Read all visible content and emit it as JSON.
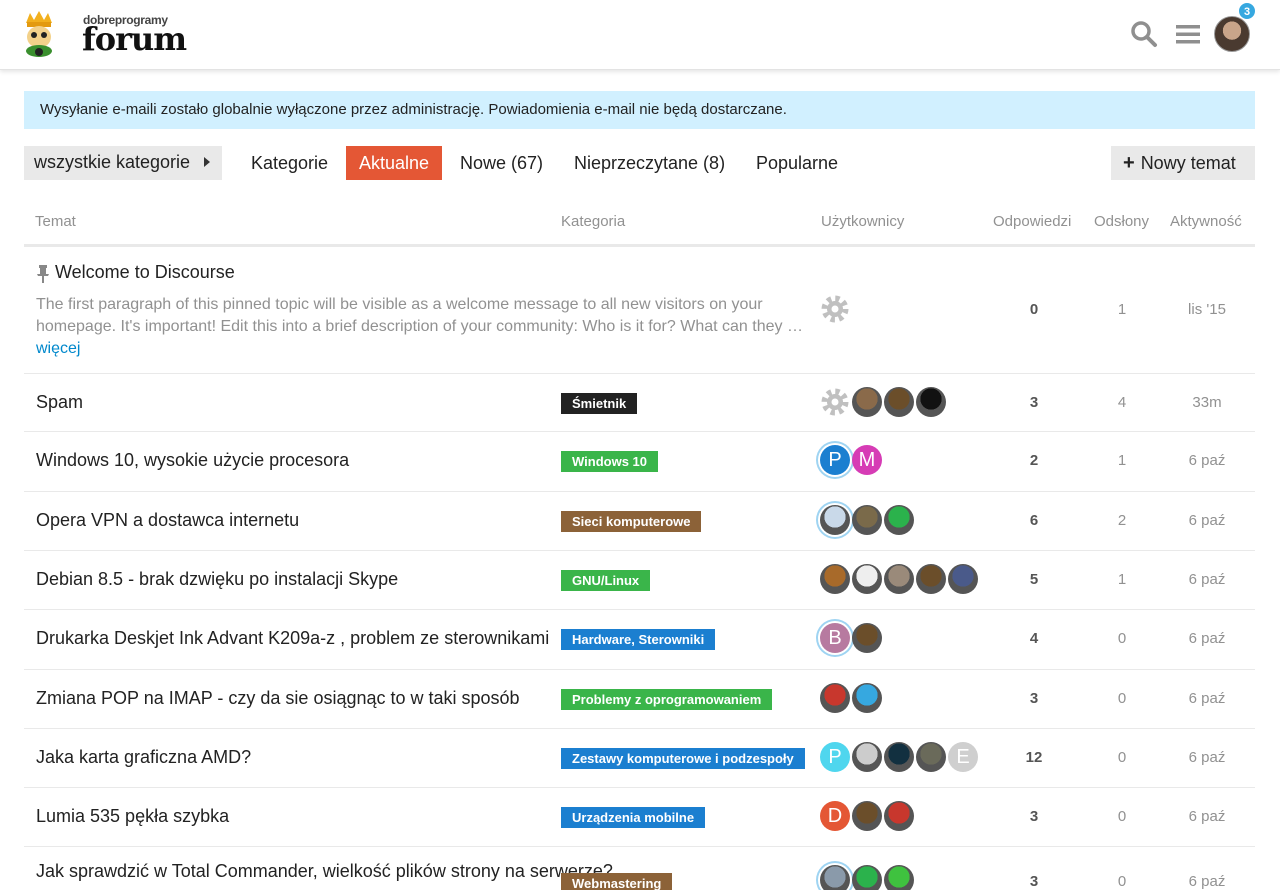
{
  "header": {
    "logo_small": "dobreprogramy",
    "logo_big": "forum",
    "notification_count": "3",
    "colors": {
      "accent": "#e45735",
      "alert_bg": "#d1f0ff",
      "badge": "#36a8e0"
    }
  },
  "alert": {
    "text": "Wysyłanie e-maili zostało globalnie wyłączone przez administrację. Powiadomienia e-mail nie będą dostarczane."
  },
  "nav": {
    "category_dropdown": "wszystkie kategorie",
    "tabs": [
      {
        "label": "Kategorie",
        "active": false
      },
      {
        "label": "Aktualne",
        "active": true
      },
      {
        "label": "Nowe (67)",
        "active": false
      },
      {
        "label": "Nieprzeczytane (8)",
        "active": false
      },
      {
        "label": "Popularne",
        "active": false
      }
    ],
    "new_topic": "Nowy temat"
  },
  "table": {
    "headers": {
      "topic": "Temat",
      "category": "Kategoria",
      "users": "Użytkownicy",
      "replies": "Odpowiedzi",
      "views": "Odsłony",
      "activity": "Aktywność"
    },
    "pinned": {
      "title": "Welcome to Discourse",
      "excerpt": "The first paragraph of this pinned topic will be visible as a welcome message to all new visitors on your homepage. It's important! Edit this into a brief description of your community: Who is it for? What can they …",
      "more": "więcej",
      "replies": "0",
      "views": "1",
      "activity": "lis '15"
    },
    "rows": [
      {
        "title": "Spam",
        "category": "Śmietnik",
        "cat_color": "#222222",
        "replies": "3",
        "views": "4",
        "activity": "33m",
        "users": [
          {
            "kind": "gear"
          },
          {
            "kind": "photo",
            "color": "#8a6a4a"
          },
          {
            "kind": "photo",
            "color": "#6b4e2a"
          },
          {
            "kind": "photo",
            "color": "#111111"
          }
        ]
      },
      {
        "title": "Windows 10, wysokie użycie procesora",
        "category": "Windows 10",
        "cat_color": "#3ab54a",
        "replies": "2",
        "views": "1",
        "activity": "6 paź",
        "users": [
          {
            "kind": "letter",
            "letter": "P",
            "color": "#1b7fd0",
            "ring": true
          },
          {
            "kind": "letter",
            "letter": "M",
            "color": "#d63cb5"
          }
        ]
      },
      {
        "title": "Opera VPN a dostawca internetu",
        "category": "Sieci komputerowe",
        "cat_color": "#8c6238",
        "replies": "6",
        "views": "2",
        "activity": "6 paź",
        "users": [
          {
            "kind": "photo",
            "color": "#c9d9e9",
            "ring": true
          },
          {
            "kind": "photo",
            "color": "#7a6a4a"
          },
          {
            "kind": "photo",
            "color": "#2bb24c"
          }
        ]
      },
      {
        "title": "Debian 8.5 - brak dzwięku po instalacji Skype",
        "category": "GNU/Linux",
        "cat_color": "#3ab54a",
        "replies": "5",
        "views": "1",
        "activity": "6 paź",
        "users": [
          {
            "kind": "photo",
            "color": "#a86a2a"
          },
          {
            "kind": "photo",
            "color": "#eeeeee"
          },
          {
            "kind": "photo",
            "color": "#9a8a7a"
          },
          {
            "kind": "photo",
            "color": "#6b4e2a"
          },
          {
            "kind": "photo",
            "color": "#4a5a8a"
          }
        ]
      },
      {
        "title": "Drukarka Deskjet Ink Advant K209a-z , problem ze sterownikami",
        "category": "Hardware, Sterowniki",
        "cat_color": "#1b7fd0",
        "replies": "4",
        "views": "0",
        "activity": "6 paź",
        "users": [
          {
            "kind": "letter",
            "letter": "B",
            "color": "#b77aa0",
            "ring": true
          },
          {
            "kind": "photo",
            "color": "#6b4e2a"
          }
        ]
      },
      {
        "title": "Zmiana POP na IMAP - czy da sie osiągnąc to w taki sposób",
        "category": "Problemy z oprogramowaniem",
        "cat_color": "#3ab54a",
        "replies": "3",
        "views": "0",
        "activity": "6 paź",
        "users": [
          {
            "kind": "photo",
            "color": "#c8372d"
          },
          {
            "kind": "photo",
            "color": "#36a8e0"
          }
        ]
      },
      {
        "title": "Jaka karta graficzna AMD?",
        "category": "Zestawy komputerowe i podzespoły",
        "cat_color": "#1b7fd0",
        "replies": "12",
        "views": "0",
        "activity": "6 paź",
        "users": [
          {
            "kind": "letter",
            "letter": "P",
            "color": "#4fd6ee"
          },
          {
            "kind": "photo",
            "color": "#cccccc"
          },
          {
            "kind": "photo",
            "color": "#123040"
          },
          {
            "kind": "photo",
            "color": "#6a6a5a"
          },
          {
            "kind": "letter",
            "letter": "E",
            "color": "#cfcfcf"
          }
        ]
      },
      {
        "title": "Lumia 535 pękła szybka",
        "category": "Urządzenia mobilne",
        "cat_color": "#1b7fd0",
        "replies": "3",
        "views": "0",
        "activity": "6 paź",
        "users": [
          {
            "kind": "letter",
            "letter": "D",
            "color": "#e45735"
          },
          {
            "kind": "photo",
            "color": "#6b4e2a"
          },
          {
            "kind": "photo",
            "color": "#c8372d"
          }
        ]
      },
      {
        "title": "Jak sprawdzić w Total Commander, wielkość plików strony na serwerze?",
        "category": "Webmastering",
        "cat_color": "#8c6238",
        "replies": "3",
        "views": "0",
        "activity": "6 paź",
        "users": [
          {
            "kind": "photo",
            "color": "#8a9aaa",
            "ring": true
          },
          {
            "kind": "photo",
            "color": "#2bb24c"
          },
          {
            "kind": "photo",
            "color": "#3fc23f"
          }
        ]
      }
    ]
  }
}
